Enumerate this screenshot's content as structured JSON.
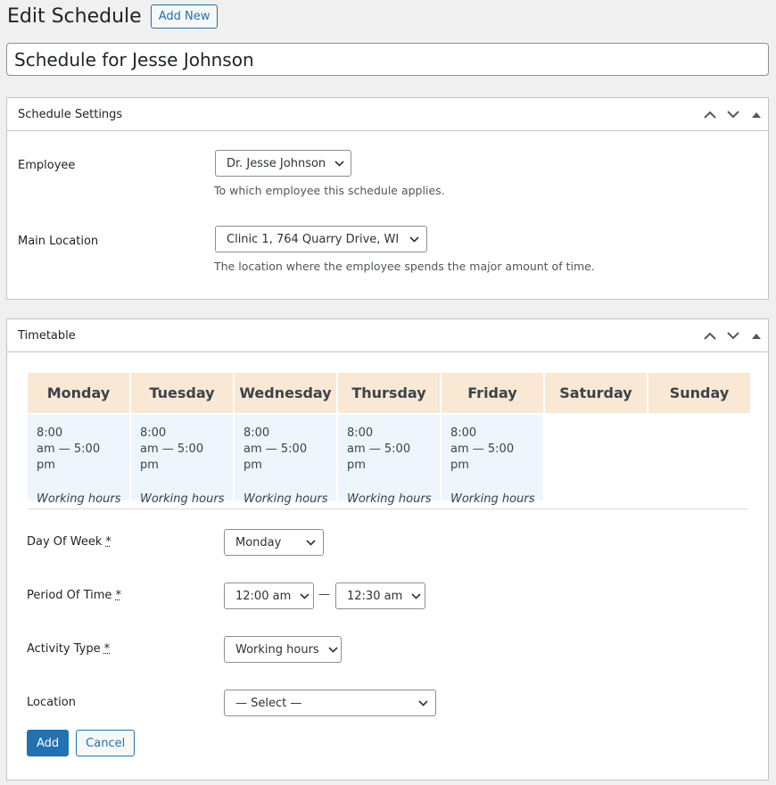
{
  "header": {
    "title": "Edit Schedule",
    "add_new_label": "Add New"
  },
  "post_title": "Schedule for Jesse Johnson",
  "settings_box": {
    "title": "Schedule Settings",
    "employee": {
      "label": "Employee",
      "value": "Dr. Jesse Johnson",
      "description": "To which employee this schedule applies."
    },
    "location": {
      "label": "Main Location",
      "value": "Clinic 1, 764 Quarry Drive, WI",
      "description": "The location where the employee spends the major amount of time."
    }
  },
  "timetable_box": {
    "title": "Timetable",
    "days": [
      "Monday",
      "Tuesday",
      "Wednesday",
      "Thursday",
      "Friday",
      "Saturday",
      "Sunday"
    ],
    "entries": [
      {
        "start": "8:00",
        "end": "am — 5:00 pm",
        "kind": "Working hours"
      },
      {
        "start": "8:00",
        "end": "am — 5:00 pm",
        "kind": "Working hours"
      },
      {
        "start": "8:00",
        "end": "am — 5:00 pm",
        "kind": "Working hours"
      },
      {
        "start": "8:00",
        "end": "am — 5:00 pm",
        "kind": "Working hours"
      },
      {
        "start": "8:00",
        "end": "am — 5:00 pm",
        "kind": "Working hours"
      }
    ],
    "form": {
      "day_label": "Day Of Week",
      "day_value": "Monday",
      "period_label": "Period Of Time",
      "period_start": "12:00 am",
      "period_sep": "—",
      "period_end": "12:30 am",
      "activity_label": "Activity Type",
      "activity_value": "Working hours",
      "location_label": "Location",
      "location_value": "— Select —",
      "required_mark": "*",
      "add_label": "Add",
      "cancel_label": "Cancel"
    }
  },
  "icons": {
    "move_up": "chevron-up-icon",
    "move_down": "chevron-down-icon",
    "toggle": "triangle-up-icon",
    "select_arrow": "chevron-down-icon"
  },
  "colors": {
    "accent": "#2271b1",
    "day_header_bg": "#f9e8d4",
    "entry_bg": "#eef5fd"
  }
}
